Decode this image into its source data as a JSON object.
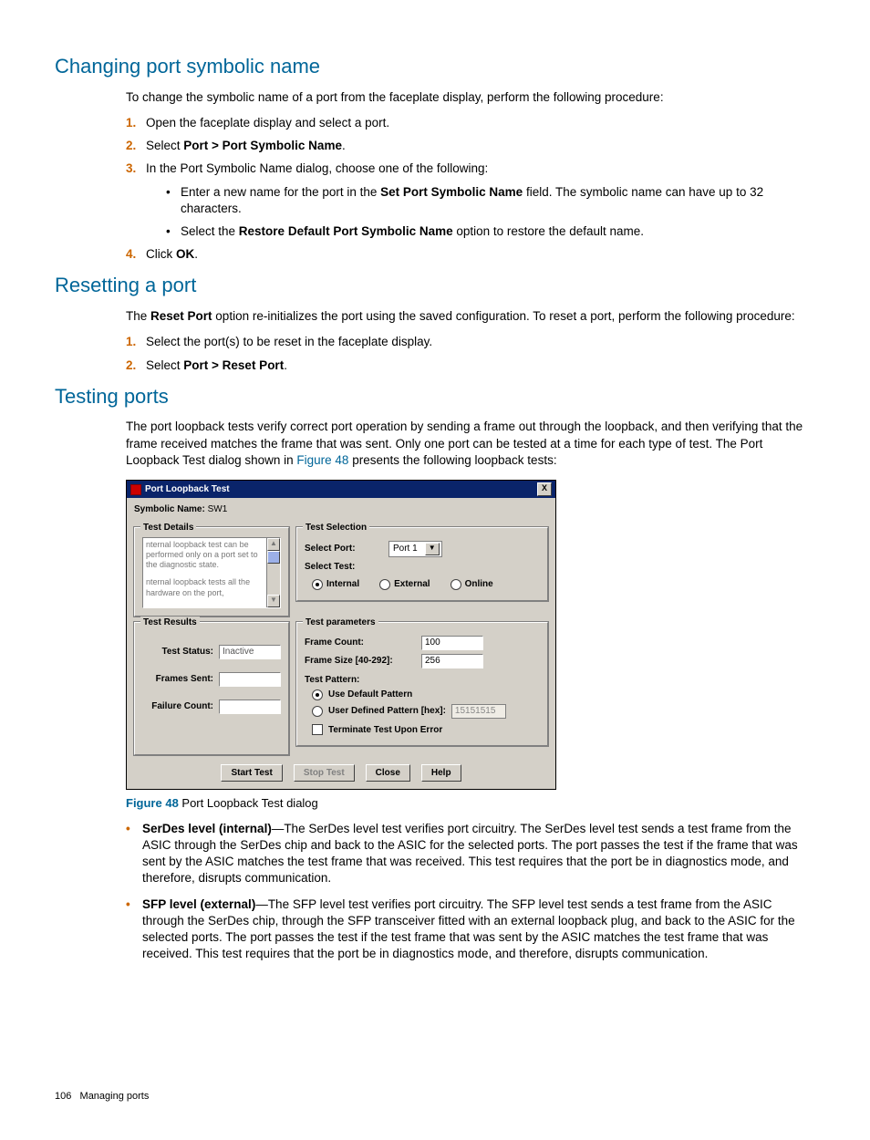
{
  "sections": {
    "s1": {
      "heading": "Changing port symbolic name",
      "intro": "To change the symbolic name of a port from the faceplate display, perform the following procedure:",
      "steps": {
        "n1": "1.",
        "t1": "Open the faceplate display and select a port.",
        "n2": "2.",
        "t2_a": "Select ",
        "t2_b": "Port > Port Symbolic Name",
        "t2_c": ".",
        "n3": "3.",
        "t3": "In the Port Symbolic Name dialog, choose one of the following:",
        "b1_a": "Enter a new name for the port in the ",
        "b1_b": "Set Port Symbolic Name",
        "b1_c": " field. The symbolic name can have up to 32 characters.",
        "b2_a": "Select the ",
        "b2_b": "Restore Default Port Symbolic Name",
        "b2_c": " option to restore the default name.",
        "n4": "4.",
        "t4_a": "Click ",
        "t4_b": "OK",
        "t4_c": "."
      }
    },
    "s2": {
      "heading": "Resetting a port",
      "intro_a": "The ",
      "intro_b": "Reset Port",
      "intro_c": " option re-initializes the port using the saved configuration. To reset a port, perform the following procedure:",
      "steps": {
        "n1": "1.",
        "t1": "Select the port(s) to be reset in the faceplate display.",
        "n2": "2.",
        "t2_a": "Select ",
        "t2_b": "Port > Reset Port",
        "t2_c": "."
      }
    },
    "s3": {
      "heading": "Testing ports",
      "intro_a": "The port loopback tests verify correct port operation by sending a frame out through the loopback, and then verifying that the frame received matches the frame that was sent. Only one port can be tested at a time for each type of test. The Port Loopback Test dialog shown in ",
      "intro_link": "Figure 48",
      "intro_b": " presents the following loopback tests:",
      "fig_label": "Figure 48",
      "fig_caption": " Port Loopback Test dialog",
      "desc": {
        "d1_b": "SerDes level (internal)",
        "d1": "—The SerDes level test verifies port circuitry. The SerDes level test sends a test frame from the ASIC through the SerDes chip and back to the ASIC for the selected ports. The port passes the test if the frame that was sent by the ASIC matches the test frame that was received. This test requires that the port be in diagnostics mode, and therefore, disrupts communication.",
        "d2_b": "SFP level (external)",
        "d2": "—The SFP level test verifies port circuitry. The SFP level test sends a test frame from the ASIC through the SerDes chip, through the SFP transceiver fitted with an external loopback plug, and back to the ASIC for the selected ports. The port passes the test if the test frame that was sent by the ASIC matches the test frame that was received. This test requires that the port be in diagnostics mode, and therefore, disrupts communication."
      }
    }
  },
  "dialog": {
    "title": "Port Loopback Test",
    "close": "X",
    "sym_label": "Symbolic Name:",
    "sym_value": "SW1",
    "test_details_legend": "Test Details",
    "test_details_text1": "nternal loopback test can be performed only on a port set to the diagnostic state.",
    "test_details_text2": "nternal loopback tests all the hardware on the port,",
    "scroll_up": "▲",
    "scroll_down": "▼",
    "test_selection_legend": "Test Selection",
    "select_port_label": "Select Port:",
    "select_port_value": "Port 1",
    "select_arrow": "▼",
    "select_test_label": "Select Test:",
    "opt_internal": "Internal",
    "opt_external": "External",
    "opt_online": "Online",
    "test_results_legend": "Test Results",
    "test_status_label": "Test Status:",
    "test_status_value": "Inactive",
    "frames_sent_label": "Frames Sent:",
    "failure_count_label": "Failure Count:",
    "test_params_legend": "Test parameters",
    "frame_count_label": "Frame Count:",
    "frame_count_value": "100",
    "frame_size_label": "Frame Size [40-292]:",
    "frame_size_value": "256",
    "test_pattern_label": "Test Pattern:",
    "use_default_label": "Use Default Pattern",
    "user_defined_label": "User Defined Pattern [hex]:",
    "user_defined_value": "15151515",
    "terminate_label": "Terminate Test Upon Error",
    "btn_start": "Start Test",
    "btn_stop": "Stop Test",
    "btn_close": "Close",
    "btn_help": "Help"
  },
  "footer": {
    "page": "106",
    "section": "Managing ports"
  }
}
